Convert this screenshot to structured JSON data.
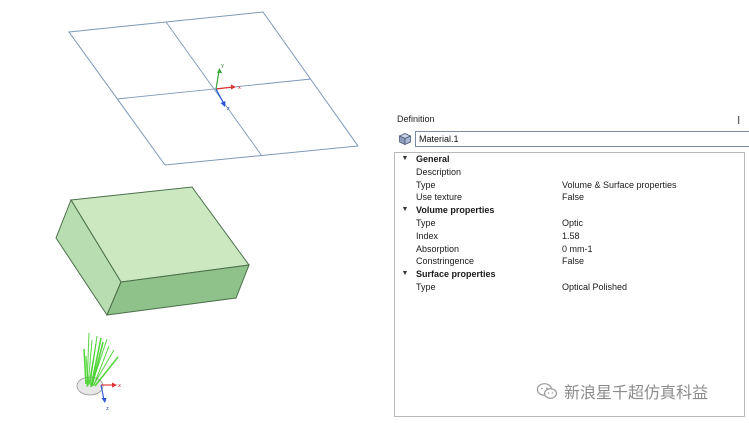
{
  "viewport": {
    "axis_labels": {
      "x": "x",
      "y": "y",
      "z": "z"
    },
    "colors": {
      "plane_edge": "#7d98b8",
      "box_light": "#cbe8c1",
      "box_mid": "#b8ddb0",
      "box_dark": "#8fc18a",
      "box_edge": "#4a6f4a",
      "rays": "#44d12a",
      "axis_x": "#e03030",
      "axis_y": "#3aa83a",
      "axis_z": "#2a55d6"
    }
  },
  "panel": {
    "title": "Definition",
    "pin_glyph": "❙",
    "name": {
      "value": "Material.1",
      "icon": "material-cube-icon"
    },
    "categories": [
      {
        "label": "General",
        "expanded": true,
        "properties": [
          {
            "name": "Description",
            "value": ""
          },
          {
            "name": "Type",
            "value": "Volume & Surface properties"
          },
          {
            "name": "Use texture",
            "value": "False"
          }
        ]
      },
      {
        "label": "Volume properties",
        "expanded": true,
        "properties": [
          {
            "name": "Type",
            "value": "Optic"
          },
          {
            "name": "Index",
            "value": "1.58"
          },
          {
            "name": "Absorption",
            "value": "0 mm-1"
          },
          {
            "name": "Constringence",
            "value": "False"
          }
        ]
      },
      {
        "label": "Surface properties",
        "expanded": true,
        "properties": [
          {
            "name": "Type",
            "value": "Optical Polished"
          }
        ]
      }
    ]
  },
  "watermark": {
    "text": "新浪星千超仿真科益",
    "icon": "wechat-icon"
  }
}
